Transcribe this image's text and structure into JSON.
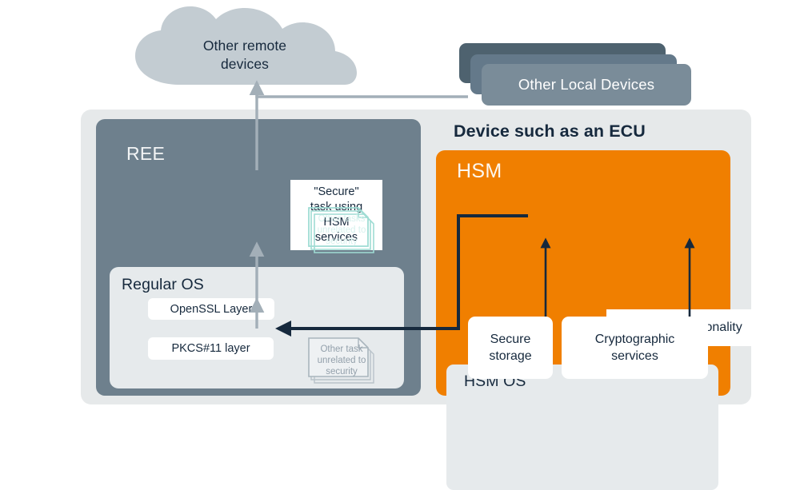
{
  "diagram": {
    "title_top": "Device such as an ECU",
    "cloud": {
      "label": "Other remote\ndevices",
      "line1": "Other remote",
      "line2": "devices",
      "fill": "#c3ccd2"
    },
    "local_devices": {
      "label": "Other Local Devices",
      "card_back_color": "#4e626f",
      "card_mid_color": "#64798a",
      "card_front_color": "#7a8c99"
    },
    "device_panel": {
      "title": "Device such as an ECU",
      "background": "#e6e9ea"
    },
    "ree": {
      "title": "REE",
      "background": "#6e808d",
      "secure_task": {
        "line1": "\"Secure\"",
        "line2": "task using",
        "line3": "HSM",
        "line4": "services"
      },
      "regular_os": {
        "title": "Regular OS",
        "background": "#e6eaec",
        "boxes": [
          {
            "label": "OpenSSL Layer"
          },
          {
            "label": "PKCS#11 layer"
          }
        ]
      },
      "note_teal": {
        "line1": "Other tasks",
        "line2": "unrelated to",
        "line3": "security",
        "stroke": "#9fdcd4"
      },
      "note_grey": {
        "line1": "Other task",
        "line2": "unrelated to",
        "line3": "security",
        "stroke": "#a9b5bd"
      }
    },
    "hsm": {
      "title": "HSM",
      "background": "#f07f00",
      "functionality_box": {
        "label": "HSM functionality"
      },
      "hsm_os": {
        "title": "HSM OS",
        "background": "#e6eaec",
        "boxes": [
          {
            "line1": "Secure",
            "line2": "storage"
          },
          {
            "line1": "Cryptographic",
            "line2": "services"
          }
        ]
      }
    },
    "connectors": {
      "arrow_dark_color": "#16293d",
      "arrow_grey_color": "#a3afb8"
    }
  }
}
